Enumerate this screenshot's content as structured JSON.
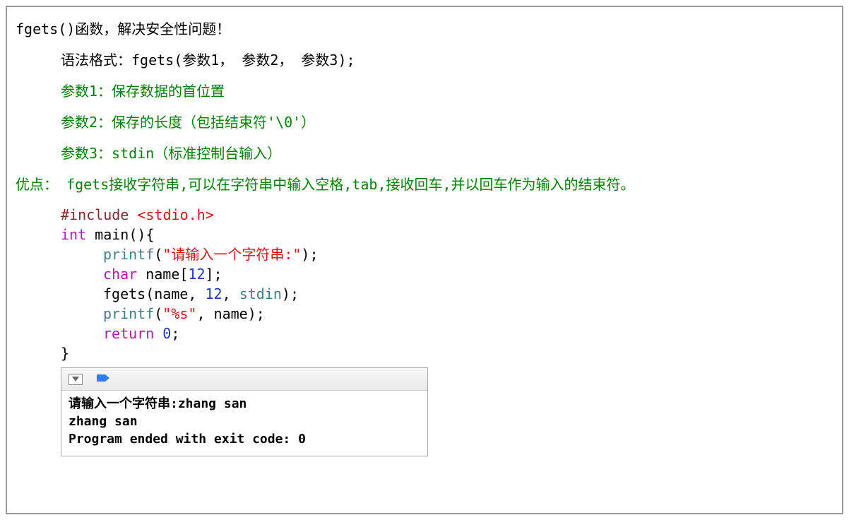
{
  "header": {
    "title": "fgets()函数，解决安全性问题！",
    "syntax": "语法格式：fgets(参数1， 参数2， 参数3);"
  },
  "params": {
    "p1": "参数1：保存数据的首位置",
    "p2": "参数2：保存的长度（包括结束符'\\0'）",
    "p3": "参数3：stdin（标准控制台输入）"
  },
  "advantage": "优点： fgets接收字符串,可以在字符串中输入空格,tab,接收回车,并以回车作为输入的结束符。",
  "code": {
    "include_kw": "#include",
    "include_hdr": "<stdio.h>",
    "int_kw": "int",
    "main_sig": " main(){",
    "printf1_name": "printf",
    "printf1_open": "(",
    "printf1_str": "\"请输入一个字符串:\"",
    "printf1_close": ");",
    "char_kw": "char",
    "char_decl": " name[",
    "char_size": "12",
    "char_close": "];",
    "fgets_name": "fgets",
    "fgets_open": "(name, ",
    "fgets_size": "12",
    "fgets_mid": ", ",
    "fgets_stdin": "stdin",
    "fgets_close": ");",
    "printf2_name": "printf",
    "printf2_open": "(",
    "printf2_str": "\"%s\"",
    "printf2_mid": ", name);",
    "return_kw": "return",
    "return_sp": " ",
    "return_val": "0",
    "return_semi": ";",
    "brace_close": "}"
  },
  "console": {
    "line1": "请输入一个字符串:zhang san",
    "line2": "zhang san",
    "line3": "Program ended with exit code: 0"
  }
}
